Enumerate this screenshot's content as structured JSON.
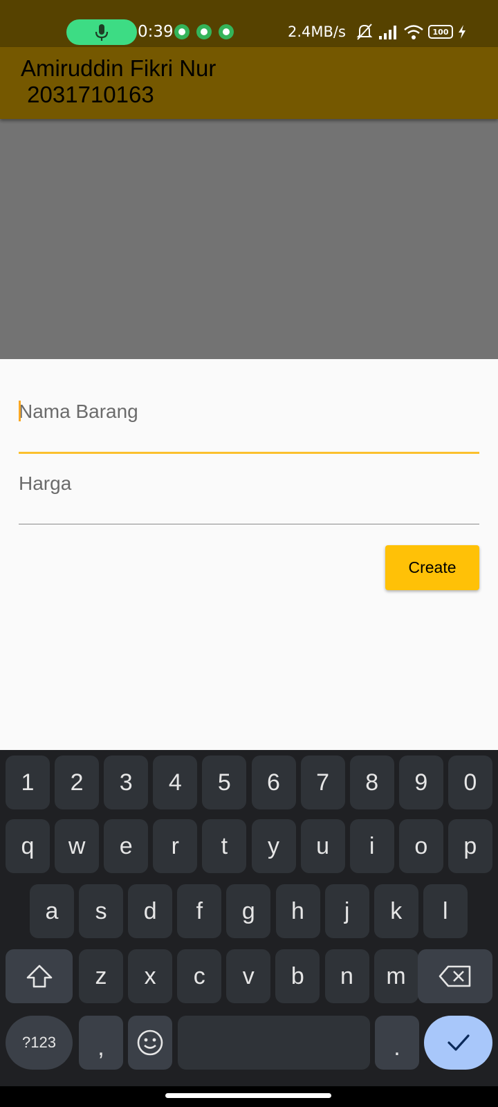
{
  "status_bar": {
    "time": "0:39",
    "net_speed": "2.4MB/s",
    "battery": "100",
    "icons": [
      "mic-icon",
      "notification-app-icon",
      "whatsapp-icon",
      "notification-app-icon",
      "mute-bell-icon",
      "signal-icon",
      "wifi-icon",
      "battery-icon",
      "charging-icon"
    ]
  },
  "app_bar": {
    "title": "Amiruddin Fikri Nur\n 2031710163"
  },
  "form": {
    "name_placeholder": "Nama Barang",
    "price_placeholder": "Harga",
    "create_label": "Create"
  },
  "colors": {
    "status_bar": "#564200",
    "app_bar": "#755800",
    "scrim": "#737373",
    "accent": "#ffc107",
    "keyboard_bg": "#1f2023",
    "enter_key": "#a8c7fa"
  },
  "keyboard": {
    "row_numbers": [
      "1",
      "2",
      "3",
      "4",
      "5",
      "6",
      "7",
      "8",
      "9",
      "0"
    ],
    "row_1": [
      "q",
      "w",
      "e",
      "r",
      "t",
      "y",
      "u",
      "i",
      "o",
      "p"
    ],
    "row_2": [
      "a",
      "s",
      "d",
      "f",
      "g",
      "h",
      "j",
      "k",
      "l"
    ],
    "row_3": [
      "z",
      "x",
      "c",
      "v",
      "b",
      "n",
      "m"
    ],
    "symbols_label": "?123",
    "comma": ",",
    "period": "."
  }
}
